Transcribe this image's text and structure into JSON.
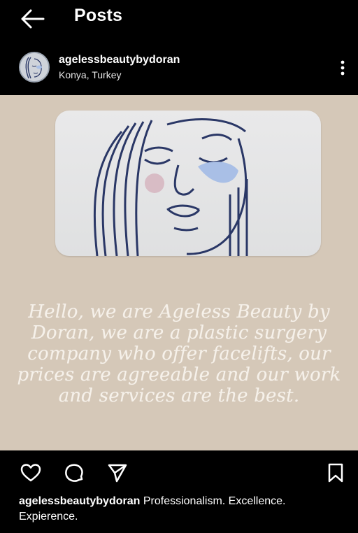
{
  "header": {
    "title": "Posts",
    "back_icon": "arrow-left-icon"
  },
  "post": {
    "username": "agelessbeautybydoran",
    "location": "Konya, Turkey",
    "more_icon": "more-vertical-icon",
    "media": {
      "background_color": "#d5c8b8",
      "overlay_text": "Hello, we are Ageless Beauty by Doran, we are a plastic surgery company who offer facelifts, our prices are agreeable and our work and services are the best."
    },
    "actions": {
      "like_icon": "heart-icon",
      "comment_icon": "comment-icon",
      "share_icon": "send-icon",
      "save_icon": "bookmark-icon"
    },
    "caption": {
      "username": "agelessbeautybydoran",
      "text": "Professionalism. Excellence. Expierence."
    }
  },
  "colors": {
    "background": "#000000",
    "text": "#ffffff",
    "line_art": "#2a3766",
    "eye_patch": "#a9bfe6",
    "blush": "#d8bcc5"
  }
}
